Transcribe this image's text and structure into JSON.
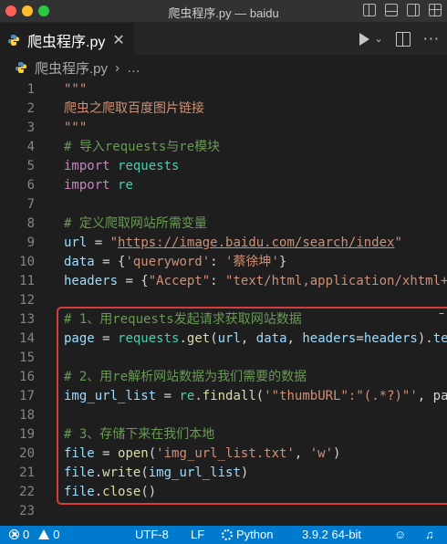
{
  "window": {
    "title": "爬虫程序.py — baidu"
  },
  "tab": {
    "label": "爬虫程序.py",
    "close_glyph": "✕"
  },
  "tab_actions": {
    "chevron": "⌄",
    "more": "···"
  },
  "breadcrumb": {
    "file": "爬虫程序.py",
    "separator": "›",
    "more": "…"
  },
  "editor": {
    "line_numbers": [
      "1",
      "2",
      "3",
      "4",
      "5",
      "6",
      "7",
      "8",
      "9",
      "10",
      "11",
      "12",
      "13",
      "14",
      "15",
      "16",
      "17",
      "18",
      "19",
      "20",
      "21",
      "22",
      "23"
    ],
    "lines": [
      [
        {
          "t": "\"\"\"",
          "c": "str"
        }
      ],
      [
        {
          "t": "爬虫之爬取百度图片链接",
          "c": "str"
        }
      ],
      [
        {
          "t": "\"\"\"",
          "c": "str"
        }
      ],
      [
        {
          "t": "# 导入requests与re模块",
          "c": "cmt"
        }
      ],
      [
        {
          "t": "import",
          "c": "kw"
        },
        {
          "t": " ",
          "c": "punc"
        },
        {
          "t": "requests",
          "c": "cls"
        }
      ],
      [
        {
          "t": "import",
          "c": "kw"
        },
        {
          "t": " ",
          "c": "punc"
        },
        {
          "t": "re",
          "c": "cls"
        }
      ],
      [],
      [
        {
          "t": "# 定义爬取网站所需变量",
          "c": "cmt"
        }
      ],
      [
        {
          "t": "url",
          "c": "var"
        },
        {
          "t": " = ",
          "c": "punc"
        },
        {
          "t": "\"",
          "c": "str"
        },
        {
          "t": "https://image.baidu.com/search/index",
          "c": "str link"
        },
        {
          "t": "\"",
          "c": "str"
        }
      ],
      [
        {
          "t": "data",
          "c": "var"
        },
        {
          "t": " = {",
          "c": "punc"
        },
        {
          "t": "'queryword'",
          "c": "str"
        },
        {
          "t": ": ",
          "c": "punc"
        },
        {
          "t": "'蔡徐坤'",
          "c": "str"
        },
        {
          "t": "}",
          "c": "punc"
        }
      ],
      [
        {
          "t": "headers",
          "c": "var"
        },
        {
          "t": " = {",
          "c": "punc"
        },
        {
          "t": "\"Accept\"",
          "c": "str"
        },
        {
          "t": ": ",
          "c": "punc"
        },
        {
          "t": "\"text/html,application/xhtml+",
          "c": "str"
        }
      ],
      [],
      [
        {
          "t": "# 1、用requests发起请求获取网站数据",
          "c": "cmt"
        }
      ],
      [
        {
          "t": "page",
          "c": "var"
        },
        {
          "t": " = ",
          "c": "punc"
        },
        {
          "t": "requests",
          "c": "cls"
        },
        {
          "t": ".",
          "c": "punc"
        },
        {
          "t": "get",
          "c": "fn"
        },
        {
          "t": "(",
          "c": "punc"
        },
        {
          "t": "url",
          "c": "var"
        },
        {
          "t": ", ",
          "c": "punc"
        },
        {
          "t": "data",
          "c": "var"
        },
        {
          "t": ", ",
          "c": "punc"
        },
        {
          "t": "headers",
          "c": "var"
        },
        {
          "t": "=",
          "c": "punc"
        },
        {
          "t": "headers",
          "c": "var"
        },
        {
          "t": ").",
          "c": "punc"
        },
        {
          "t": "te",
          "c": "var"
        }
      ],
      [],
      [
        {
          "t": "# 2、用re解析网站数据为我们需要的数据",
          "c": "cmt"
        }
      ],
      [
        {
          "t": "img_url_list",
          "c": "var"
        },
        {
          "t": " = ",
          "c": "punc"
        },
        {
          "t": "re",
          "c": "cls"
        },
        {
          "t": ".",
          "c": "punc"
        },
        {
          "t": "findall",
          "c": "fn"
        },
        {
          "t": "(",
          "c": "punc"
        },
        {
          "t": "'\"thumbURL\":\"(.*?)\"'",
          "c": "str"
        },
        {
          "t": ", pa",
          "c": "punc"
        }
      ],
      [],
      [
        {
          "t": "# 3、存储下来在我们本地",
          "c": "cmt"
        }
      ],
      [
        {
          "t": "file",
          "c": "var"
        },
        {
          "t": " = ",
          "c": "punc"
        },
        {
          "t": "open",
          "c": "fn"
        },
        {
          "t": "(",
          "c": "punc"
        },
        {
          "t": "'img_url_list.txt'",
          "c": "str"
        },
        {
          "t": ", ",
          "c": "punc"
        },
        {
          "t": "'w'",
          "c": "str"
        },
        {
          "t": ")",
          "c": "punc"
        }
      ],
      [
        {
          "t": "file",
          "c": "var"
        },
        {
          "t": ".",
          "c": "punc"
        },
        {
          "t": "write",
          "c": "fn"
        },
        {
          "t": "(",
          "c": "punc"
        },
        {
          "t": "img_url_list",
          "c": "var"
        },
        {
          "t": ")",
          "c": "punc"
        }
      ],
      [
        {
          "t": "file",
          "c": "var"
        },
        {
          "t": ".",
          "c": "punc"
        },
        {
          "t": "close",
          "c": "fn"
        },
        {
          "t": "()",
          "c": "punc"
        }
      ],
      []
    ],
    "fold_hint": "–"
  },
  "statusbar": {
    "errors": "0",
    "warnings": "0",
    "encoding": "UTF-8",
    "eol": "LF",
    "language": "Python",
    "interpreter": "3.9.2 64-bit"
  },
  "colors": {
    "statusbar": "#007acc",
    "highlight_border": "#d93a3a",
    "editor_bg": "#1e1e1e"
  }
}
